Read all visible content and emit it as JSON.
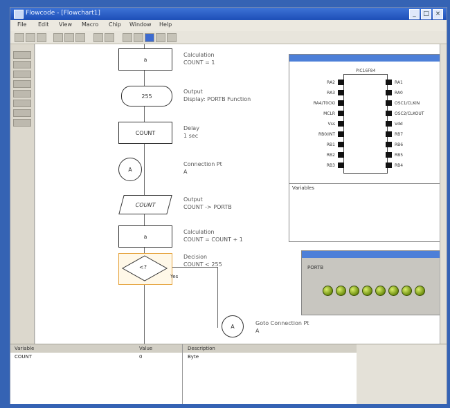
{
  "window": {
    "title": "Flowcode - [Flowchart1]"
  },
  "window_buttons": [
    "_",
    "□",
    "×"
  ],
  "menu": [
    "File",
    "Edit",
    "View",
    "Macro",
    "Chip",
    "Window",
    "Help"
  ],
  "flowchart": {
    "blocks": [
      {
        "label": "a",
        "title": "Calculation",
        "detail": "COUNT = 1"
      },
      {
        "label": "255",
        "title": "Output",
        "detail": "Display: PORTB Function"
      },
      {
        "label": "COUNT",
        "title": "Delay",
        "detail": "1 sec"
      },
      {
        "label": "A",
        "title": "Connection Pt",
        "detail": "A"
      },
      {
        "label": "COUNT",
        "title": "Output",
        "detail": "COUNT -> PORTB"
      },
      {
        "label": "a",
        "title": "Calculation",
        "detail": "COUNT = COUNT + 1"
      },
      {
        "label": "<?",
        "title": "Decision",
        "detail": "COUNT < 255",
        "yes": "Yes"
      },
      {
        "label": "A",
        "title": "Goto Connection Pt",
        "detail": "A"
      }
    ]
  },
  "chip_panel": {
    "chip_name": "PIC16F84",
    "left_pins": [
      "RA2",
      "RA3",
      "RA4/T0CKI",
      "MCLR",
      "Vss",
      "RB0/INT",
      "RB1",
      "RB2",
      "RB3"
    ],
    "right_pins": [
      "RA1",
      "RA0",
      "OSC1/CLKIN",
      "OSC2/CLKOUT",
      "Vdd",
      "RB7",
      "RB6",
      "RB5",
      "RB4"
    ],
    "footer": "Variables"
  },
  "led_panel": {
    "label": "PORTB",
    "count": 8
  },
  "bottom_table": {
    "headers": [
      "Variable",
      "Value",
      "Description"
    ],
    "row": [
      "COUNT",
      "0",
      "Byte"
    ]
  }
}
